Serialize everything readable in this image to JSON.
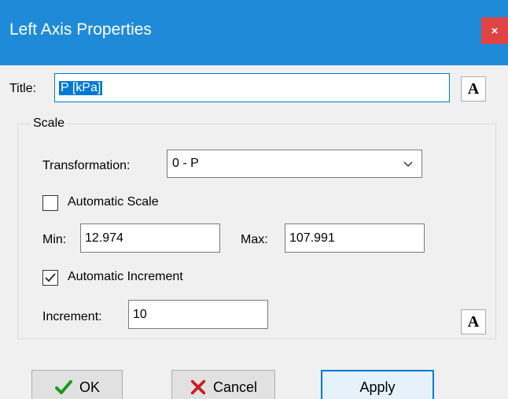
{
  "window": {
    "title": "Left Axis Properties",
    "close_glyph": "×"
  },
  "title_field": {
    "label": "Title:",
    "value": "P [kPa]"
  },
  "font_button": {
    "glyph": "A"
  },
  "scale_group": {
    "caption": "Scale",
    "transformation": {
      "label": "Transformation:",
      "selected": "0 - P"
    },
    "automatic_scale": {
      "label": "Automatic Scale",
      "checked": false
    },
    "min": {
      "label": "Min:",
      "value": "12.974"
    },
    "max": {
      "label": "Max:",
      "value": "107.991"
    },
    "automatic_increment": {
      "label": "Automatic Increment",
      "checked": true
    },
    "increment": {
      "label": "Increment:",
      "value": "10"
    },
    "increment_font_button": {
      "glyph": "A"
    }
  },
  "buttons": {
    "ok": {
      "label": "OK",
      "icon": "checkmark-icon",
      "color": "#1a9a1a"
    },
    "cancel": {
      "label": "Cancel",
      "icon": "x-icon",
      "color": "#c81e1e"
    },
    "apply": {
      "label": "Apply"
    }
  },
  "colors": {
    "titlebar": "#1f8ad8",
    "close": "#e04343",
    "accent": "#0078d7"
  }
}
